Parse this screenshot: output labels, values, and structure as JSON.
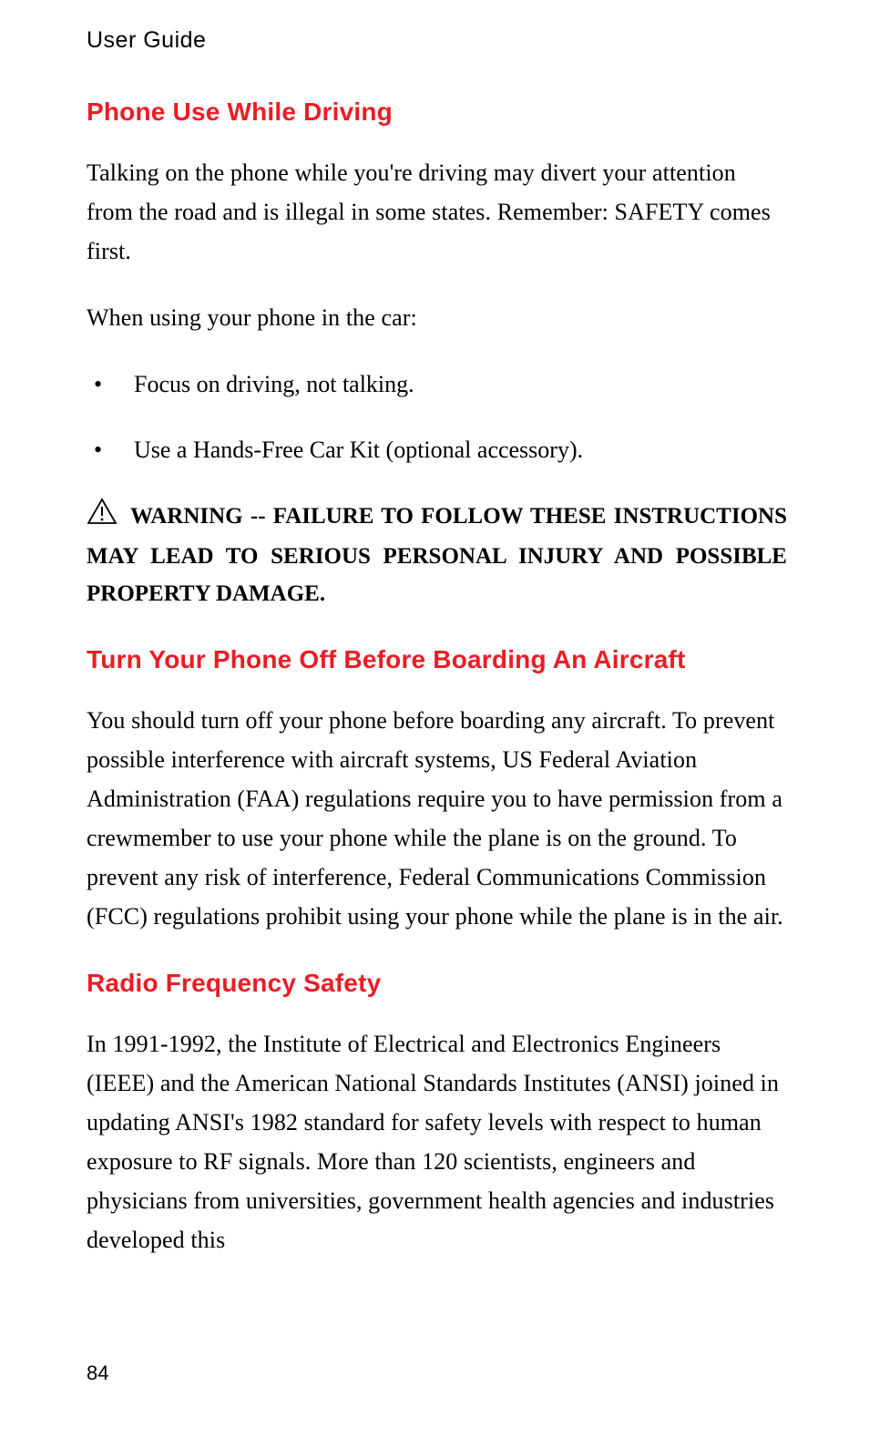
{
  "running_header": "User Guide",
  "page_number": "84",
  "sections": [
    {
      "heading": "Phone Use While Driving",
      "paras": [
        "Talking on the phone while you're driving may divert your attention from the road and is illegal in some states. Remember: SAFETY comes first.",
        "When using your phone in the car:"
      ],
      "bullets": [
        "Focus on driving, not talking.",
        "Use a Hands-Free Car Kit (optional accessory)."
      ],
      "warning": {
        "icon_name": "warning-triangle-icon",
        "text": "WARNING -- FAILURE TO FOLLOW THESE INSTRUCTIONS MAY LEAD TO SERIOUS PERSONAL INJURY AND POSSIBLE PROPERTY DAMAGE."
      }
    },
    {
      "heading": "Turn Your Phone Off Before Boarding An Aircraft",
      "paras": [
        "You should turn off your phone before boarding any aircraft. To prevent possible interference with aircraft systems, US Federal Aviation Administration (FAA) regulations require you to have permission from a crewmember to use your phone while the plane is on the ground. To prevent any risk of interference, Federal Communications Commission (FCC) regulations prohibit using your phone while the plane is in the air."
      ]
    },
    {
      "heading": "Radio Frequency Safety",
      "paras": [
        "In 1991-1992, the Institute of Electrical and Electronics Engineers (IEEE) and the American National Standards Institutes (ANSI) joined in updating ANSI's 1982 standard for safety levels with respect to human exposure to RF signals. More than 120 scientists, engineers and physicians from universities, government health agencies and industries developed this"
      ]
    }
  ]
}
